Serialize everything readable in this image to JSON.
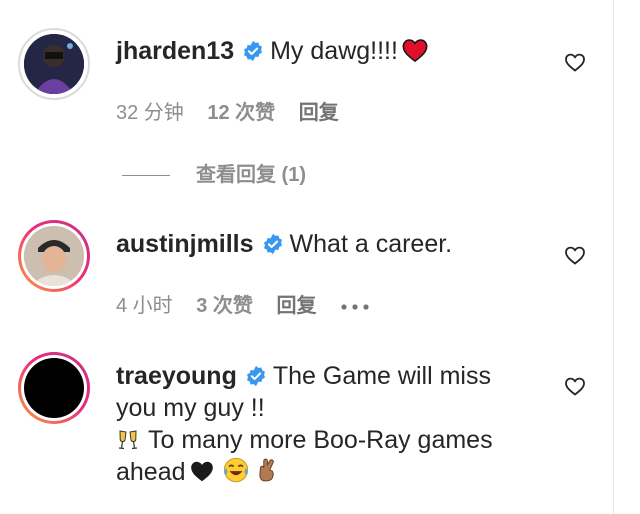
{
  "colors": {
    "verified": "#3897f0",
    "muted": "#8e8e8e",
    "text": "#262626",
    "like_red": "#ed4956"
  },
  "comments": [
    {
      "username": "jharden13",
      "text": "My dawg!!!!",
      "time": "32 分钟",
      "likes": "12 次赞",
      "reply": "回复",
      "view_replies": "查看回复 (1)"
    },
    {
      "username": "austinjmills",
      "text": "What a career.",
      "time": "4 小时",
      "likes": "3 次赞",
      "reply": "回复"
    },
    {
      "username": "traeyoung",
      "text_line1": "The Game will miss",
      "text_line2": "you my guy !!",
      "text_line3": "To many more Boo-Ray games",
      "text_line4": "ahead"
    }
  ],
  "icons": [
    "verified-badge-icon",
    "heart-outline-icon",
    "red-heart-emoji",
    "more-options-icon",
    "clinking-glasses-emoji",
    "black-heart-emoji",
    "tears-of-joy-emoji",
    "crossed-fingers-emoji"
  ]
}
